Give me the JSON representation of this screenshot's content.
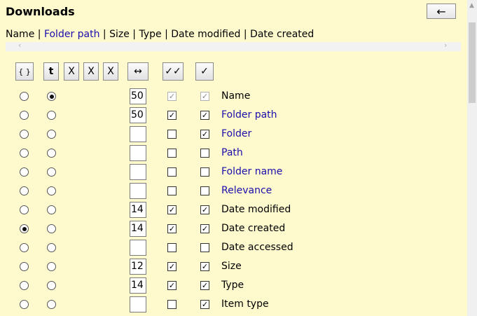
{
  "header": {
    "title": "Downloads",
    "back_icon": "←"
  },
  "crumbs": [
    {
      "text": "Name",
      "link": false
    },
    {
      "text": " | ",
      "link": false
    },
    {
      "text": "Folder path",
      "link": true
    },
    {
      "text": " | Size | Type | Date modified | Date created",
      "link": false
    }
  ],
  "toolbar": {
    "buttons": [
      {
        "name": "braces-button",
        "label": "{ }"
      },
      {
        "name": "t-button",
        "label": "t"
      },
      {
        "name": "x-button-1",
        "label": "X"
      },
      {
        "name": "x-button-2",
        "label": "X"
      },
      {
        "name": "x-button-3",
        "label": "X"
      },
      {
        "name": "width-button",
        "label": "↔"
      },
      {
        "name": "check-all-button",
        "label": "✓✓"
      },
      {
        "name": "check-button",
        "label": "✓"
      }
    ]
  },
  "rows": [
    {
      "label": "Name",
      "link": false,
      "sort": false,
      "group": true,
      "width": "50",
      "visible": true,
      "enabled": true,
      "disabled": true
    },
    {
      "label": "Folder path",
      "link": true,
      "sort": false,
      "group": false,
      "width": "50",
      "visible": true,
      "enabled": true,
      "disabled": false
    },
    {
      "label": "Folder",
      "link": true,
      "sort": false,
      "group": false,
      "width": "",
      "visible": false,
      "enabled": true,
      "disabled": false
    },
    {
      "label": "Path",
      "link": true,
      "sort": false,
      "group": false,
      "width": "",
      "visible": false,
      "enabled": false,
      "disabled": false
    },
    {
      "label": "Folder name",
      "link": true,
      "sort": false,
      "group": false,
      "width": "",
      "visible": false,
      "enabled": false,
      "disabled": false
    },
    {
      "label": "Relevance",
      "link": true,
      "sort": false,
      "group": false,
      "width": "",
      "visible": false,
      "enabled": false,
      "disabled": false
    },
    {
      "label": "Date modified",
      "link": false,
      "sort": false,
      "group": false,
      "width": "14",
      "visible": true,
      "enabled": true,
      "disabled": false
    },
    {
      "label": "Date created",
      "link": false,
      "sort": true,
      "group": false,
      "width": "14",
      "visible": true,
      "enabled": true,
      "disabled": false
    },
    {
      "label": "Date accessed",
      "link": false,
      "sort": false,
      "group": false,
      "width": "",
      "visible": false,
      "enabled": false,
      "disabled": false
    },
    {
      "label": "Size",
      "link": false,
      "sort": false,
      "group": false,
      "width": "12",
      "visible": true,
      "enabled": true,
      "disabled": false
    },
    {
      "label": "Type",
      "link": false,
      "sort": false,
      "group": false,
      "width": "14",
      "visible": true,
      "enabled": true,
      "disabled": false
    },
    {
      "label": "Item type",
      "link": false,
      "sort": false,
      "group": false,
      "width": "",
      "visible": false,
      "enabled": true,
      "disabled": false
    }
  ],
  "glyphs": {
    "check": "✓",
    "scroll_left": "‹",
    "scroll_right": "›",
    "scroll_up": "▲"
  }
}
